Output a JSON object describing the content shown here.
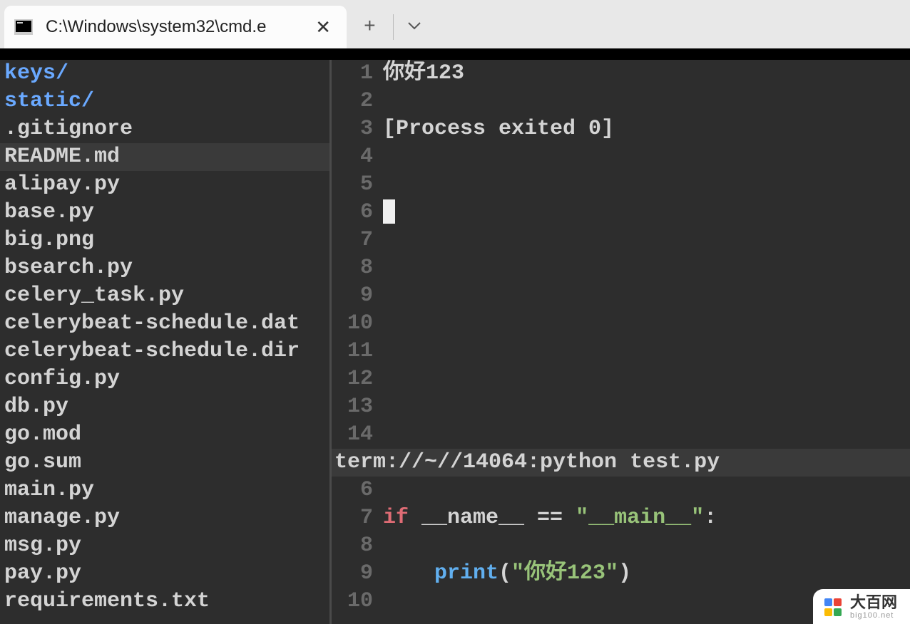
{
  "tab": {
    "title": "C:\\Windows\\system32\\cmd.e"
  },
  "sidebar": {
    "files": [
      {
        "name": "keys/",
        "type": "dir"
      },
      {
        "name": "static/",
        "type": "dir"
      },
      {
        "name": ".gitignore",
        "type": "file"
      },
      {
        "name": "README.md",
        "type": "file",
        "selected": true
      },
      {
        "name": "alipay.py",
        "type": "file"
      },
      {
        "name": "base.py",
        "type": "file"
      },
      {
        "name": "big.png",
        "type": "file"
      },
      {
        "name": "bsearch.py",
        "type": "file"
      },
      {
        "name": "celery_task.py",
        "type": "file"
      },
      {
        "name": "celerybeat-schedule.dat",
        "type": "file"
      },
      {
        "name": "celerybeat-schedule.dir",
        "type": "file"
      },
      {
        "name": "config.py",
        "type": "file"
      },
      {
        "name": "db.py",
        "type": "file"
      },
      {
        "name": "go.mod",
        "type": "file"
      },
      {
        "name": "go.sum",
        "type": "file"
      },
      {
        "name": "main.py",
        "type": "file"
      },
      {
        "name": "manage.py",
        "type": "file"
      },
      {
        "name": "msg.py",
        "type": "file"
      },
      {
        "name": "pay.py",
        "type": "file"
      },
      {
        "name": "requirements.txt",
        "type": "file"
      }
    ]
  },
  "terminal": {
    "lines": [
      {
        "num": "1",
        "text": "你好123"
      },
      {
        "num": "2",
        "text": ""
      },
      {
        "num": "3",
        "text": "[Process exited 0]"
      },
      {
        "num": "4",
        "text": ""
      },
      {
        "num": "5",
        "text": ""
      },
      {
        "num": "6",
        "text": "",
        "cursor": true
      },
      {
        "num": "7",
        "text": ""
      },
      {
        "num": "8",
        "text": ""
      },
      {
        "num": "9",
        "text": ""
      },
      {
        "num": "10",
        "text": ""
      },
      {
        "num": "11",
        "text": ""
      },
      {
        "num": "12",
        "text": ""
      },
      {
        "num": "13",
        "text": ""
      },
      {
        "num": "14",
        "text": ""
      }
    ],
    "status": "term://~//14064:python test.py"
  },
  "code": {
    "lines": [
      {
        "num": "6",
        "tokens": [
          {
            "t": "",
            "c": ""
          }
        ]
      },
      {
        "num": "7",
        "tokens": [
          {
            "t": "if",
            "c": "kw"
          },
          {
            "t": " __name__ == ",
            "c": ""
          },
          {
            "t": "\"__main__\"",
            "c": "str"
          },
          {
            "t": ":",
            "c": ""
          }
        ]
      },
      {
        "num": "8",
        "tokens": [
          {
            "t": "",
            "c": ""
          }
        ]
      },
      {
        "num": "9",
        "tokens": [
          {
            "t": "    ",
            "c": ""
          },
          {
            "t": "print",
            "c": "fn"
          },
          {
            "t": "(",
            "c": ""
          },
          {
            "t": "\"你好123\"",
            "c": "str"
          },
          {
            "t": ")",
            "c": ""
          }
        ]
      },
      {
        "num": "10",
        "tokens": [
          {
            "t": "",
            "c": ""
          }
        ]
      }
    ]
  },
  "watermark": {
    "main": "大百网",
    "sub": "big100.net",
    "colors": [
      "#4285f4",
      "#ea4335",
      "#fbbc05",
      "#34a853"
    ]
  }
}
